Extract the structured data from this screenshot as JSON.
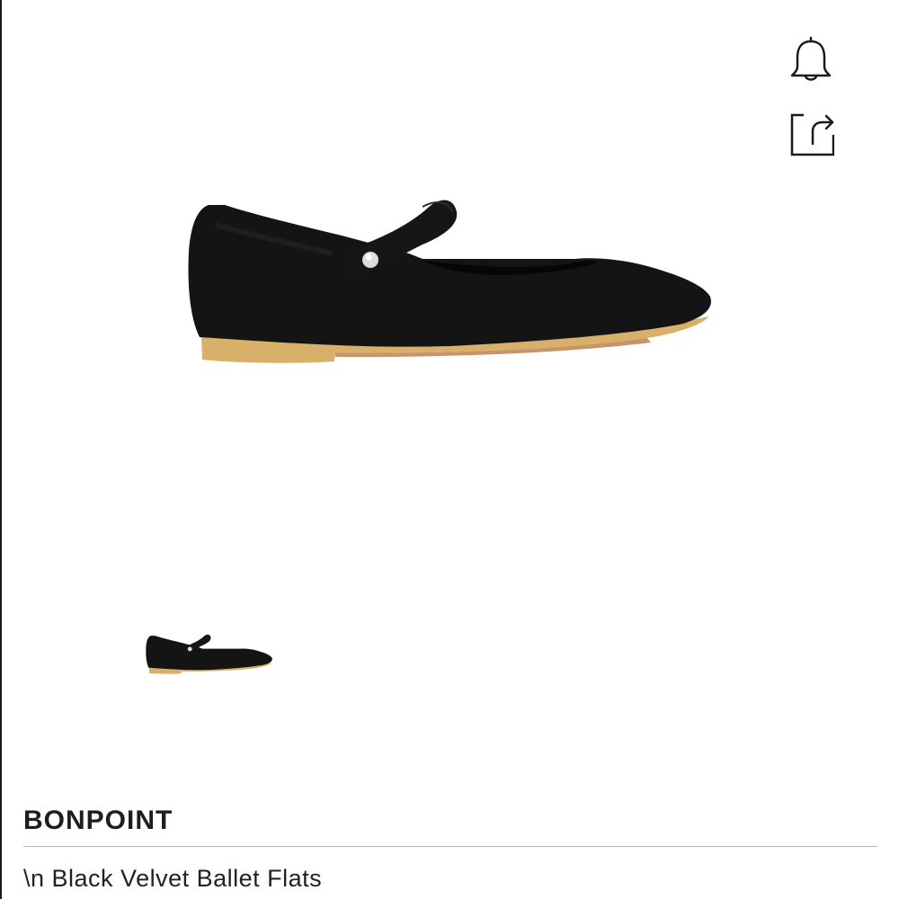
{
  "icons": {
    "notify": "bell-icon",
    "share": "share-icon"
  },
  "product": {
    "brand": "BONPOINT",
    "title": "\\n Black Velvet Ballet Flats",
    "image_alt": "Black velvet Mary Jane ballet flat with pearl button strap and natural sole",
    "thumbnail_alt": "Thumbnail of black velvet ballet flat"
  },
  "colors": {
    "velvet": "#141414",
    "sole": "#d9b06a",
    "divider": "#b5b5b5",
    "text": "#1e1e1e"
  }
}
